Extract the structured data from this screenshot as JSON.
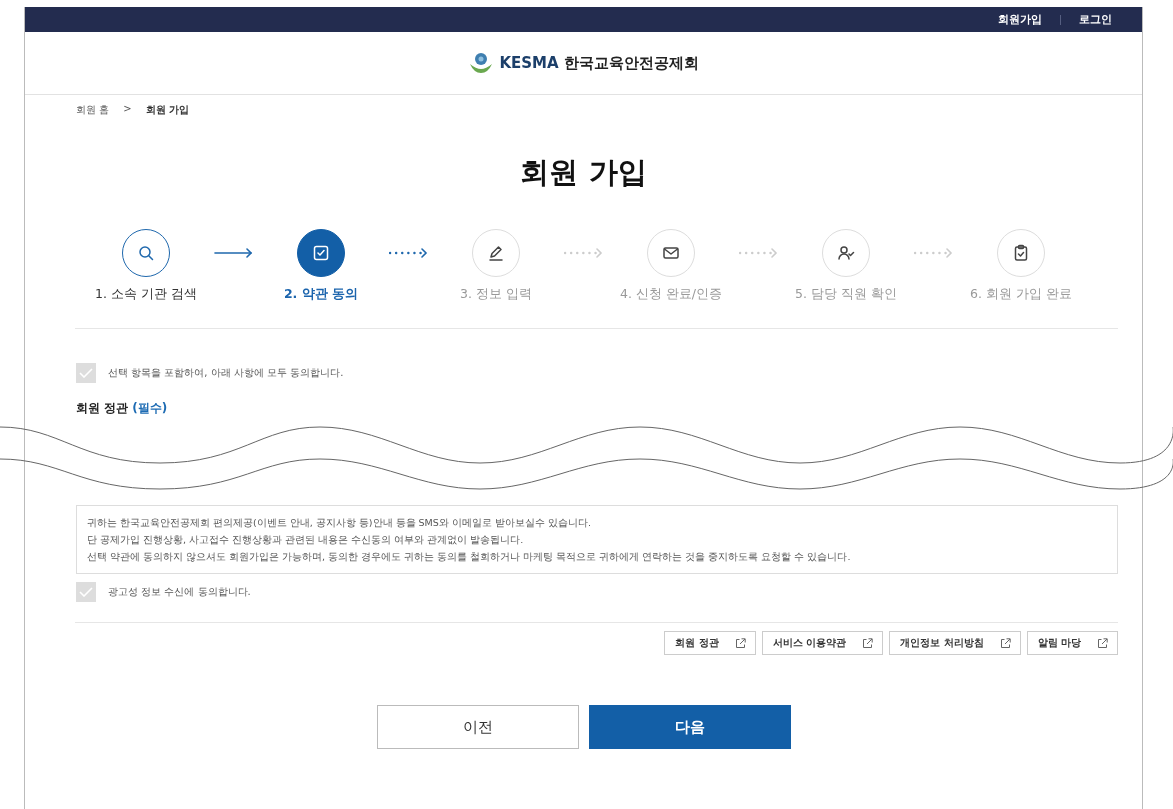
{
  "top_bar": {
    "links": [
      "회원가입",
      "로그인"
    ]
  },
  "header": {
    "logo_text": "KESMA",
    "org_name": "한국교육안전공제회"
  },
  "breadcrumb": [
    "회원 홈",
    ">",
    "회원 가입"
  ],
  "page_title": "회원 가입",
  "steps": [
    {
      "label": "1. 소속 기관 검색",
      "done": true,
      "selected": false
    },
    {
      "label": "2. 약관 동의",
      "done": false,
      "selected": true
    },
    {
      "label": "3. 정보 입력",
      "done": false,
      "selected": false
    },
    {
      "label": "4. 신청 완료/인증",
      "done": false,
      "selected": false
    },
    {
      "label": "5. 담당 직원 확인",
      "done": false,
      "selected": false
    },
    {
      "label": "6. 회원 가입 완료",
      "done": false,
      "selected": false
    }
  ],
  "agree_all": {
    "label": "선택 항목을 포함하여, 아래 사항에 모두 동의합니다.",
    "checked": true
  },
  "section_title": {
    "text": "회원 정관",
    "tag": "(필수)"
  },
  "marketing_notice": [
    "귀하는 한국교육안전공제회 편의제공(이벤트 안내, 공지사항 등)안내 등을 SMS와 이메일로 받아보실수 있습니다.",
    "단 공제가입 진행상황, 사고접수 진행상황과 관련된 내용은 수신동의 여부와 관계없이 발송됩니다.",
    "선택 약관에 동의하지 않으셔도 회원가입은 가능하며, 동의한 경우에도 귀하는 동의를 철회하거나 마케팅 목적으로 귀하에게 연락하는 것을 중지하도록 요청할 수 있습니다."
  ],
  "marketing_agree": {
    "label": "광고성 정보 수신에 동의합니다.",
    "checked": true
  },
  "doc_links": [
    "회원 정관",
    "서비스 이용약관",
    "개인정보 처리방침",
    "알림 마당"
  ],
  "buttons": {
    "prev": "이전",
    "next": "다음"
  }
}
